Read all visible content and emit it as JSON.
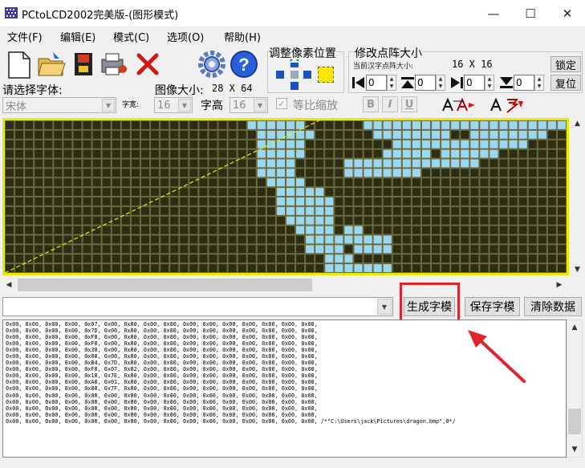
{
  "window": {
    "title": "PCtoLCD2002完美版-(图形模式)",
    "minimize_glyph": "—",
    "maximize_glyph": "☐",
    "close_glyph": "✕"
  },
  "menu": [
    "文件(F)",
    "编辑(E)",
    "模式(C)",
    "选项(O)",
    "帮助(H)"
  ],
  "toolbar": {
    "adjust_pixel_label": "调整像素位置",
    "resize_label": "修改点阵大小",
    "current_size_label": "当前汉字点阵大小:",
    "current_size_value": "16 X 16",
    "lock_button": "锁定",
    "reset_button": "复位"
  },
  "font": {
    "select_label": "请选择字体:",
    "font_value": "宋体",
    "width_label": "字宽:",
    "width_value": "16",
    "height_label": "字高",
    "height_value": "16",
    "scale_label": "等比缩放",
    "image_size_label": "图像大小:",
    "image_size_value": "28 X 64",
    "bold_label": "B",
    "italic_label": "I",
    "underline_label": "U"
  },
  "spinners": [
    "0",
    "0",
    "0",
    "0"
  ],
  "actions": {
    "generate_button": "生成字模",
    "save_button": "保存字模",
    "clear_button": "清除数据"
  },
  "colors": {
    "grid_background": "#2d2d14",
    "pixel_on": "#9cd7f0",
    "grid_frame": "#eaea00",
    "highlight_box": "#e0242b",
    "arrow": "#e0242b"
  },
  "grid": {
    "cols": 58,
    "rows": 16,
    "on_cells": [
      [
        0,
        25
      ],
      [
        0,
        26
      ],
      [
        0,
        27
      ],
      [
        0,
        28
      ],
      [
        0,
        29
      ],
      [
        0,
        30
      ],
      [
        0,
        37
      ],
      [
        0,
        38
      ],
      [
        0,
        39
      ],
      [
        0,
        40
      ],
      [
        0,
        41
      ],
      [
        0,
        42
      ],
      [
        0,
        43
      ],
      [
        0,
        44
      ],
      [
        0,
        45
      ],
      [
        0,
        46
      ],
      [
        0,
        47
      ],
      [
        0,
        48
      ],
      [
        0,
        49
      ],
      [
        0,
        50
      ],
      [
        0,
        51
      ],
      [
        0,
        52
      ],
      [
        0,
        53
      ],
      [
        0,
        54
      ],
      [
        0,
        55
      ],
      [
        0,
        56
      ],
      [
        0,
        57
      ],
      [
        1,
        26
      ],
      [
        1,
        27
      ],
      [
        1,
        28
      ],
      [
        1,
        29
      ],
      [
        1,
        30
      ],
      [
        1,
        31
      ],
      [
        1,
        38
      ],
      [
        1,
        39
      ],
      [
        1,
        40
      ],
      [
        1,
        41
      ],
      [
        1,
        42
      ],
      [
        1,
        43
      ],
      [
        1,
        44
      ],
      [
        1,
        45
      ],
      [
        1,
        48
      ],
      [
        1,
        49
      ],
      [
        1,
        50
      ],
      [
        1,
        51
      ],
      [
        1,
        52
      ],
      [
        1,
        53
      ],
      [
        1,
        54
      ],
      [
        1,
        55
      ],
      [
        2,
        26
      ],
      [
        2,
        27
      ],
      [
        2,
        28
      ],
      [
        2,
        29
      ],
      [
        2,
        30
      ],
      [
        2,
        40
      ],
      [
        2,
        41
      ],
      [
        2,
        42
      ],
      [
        2,
        43
      ],
      [
        2,
        44
      ],
      [
        2,
        45
      ],
      [
        2,
        46
      ],
      [
        2,
        47
      ],
      [
        2,
        48
      ],
      [
        2,
        49
      ],
      [
        2,
        50
      ],
      [
        2,
        51
      ],
      [
        2,
        52
      ],
      [
        2,
        53
      ],
      [
        3,
        26
      ],
      [
        3,
        27
      ],
      [
        3,
        28
      ],
      [
        3,
        29
      ],
      [
        3,
        30
      ],
      [
        3,
        39
      ],
      [
        3,
        40
      ],
      [
        3,
        41
      ],
      [
        3,
        42
      ],
      [
        3,
        43
      ],
      [
        3,
        45
      ],
      [
        3,
        46
      ],
      [
        3,
        47
      ],
      [
        3,
        48
      ],
      [
        3,
        49
      ],
      [
        3,
        50
      ],
      [
        4,
        26
      ],
      [
        4,
        27
      ],
      [
        4,
        28
      ],
      [
        4,
        29
      ],
      [
        4,
        35
      ],
      [
        4,
        36
      ],
      [
        4,
        37
      ],
      [
        4,
        38
      ],
      [
        4,
        39
      ],
      [
        4,
        40
      ],
      [
        4,
        41
      ],
      [
        4,
        42
      ],
      [
        4,
        43
      ],
      [
        4,
        44
      ],
      [
        4,
        45
      ],
      [
        4,
        46
      ],
      [
        4,
        47
      ],
      [
        4,
        48
      ],
      [
        5,
        26
      ],
      [
        5,
        27
      ],
      [
        5,
        28
      ],
      [
        5,
        29
      ],
      [
        5,
        35
      ],
      [
        5,
        36
      ],
      [
        5,
        37
      ],
      [
        5,
        38
      ],
      [
        5,
        39
      ],
      [
        5,
        40
      ],
      [
        5,
        41
      ],
      [
        5,
        42
      ],
      [
        6,
        27
      ],
      [
        6,
        28
      ],
      [
        6,
        29
      ],
      [
        6,
        30
      ],
      [
        7,
        28
      ],
      [
        7,
        29
      ],
      [
        7,
        30
      ],
      [
        7,
        31
      ],
      [
        7,
        32
      ],
      [
        8,
        28
      ],
      [
        8,
        29
      ],
      [
        8,
        30
      ],
      [
        8,
        31
      ],
      [
        8,
        32
      ],
      [
        8,
        33
      ],
      [
        9,
        28
      ],
      [
        9,
        29
      ],
      [
        9,
        30
      ],
      [
        9,
        31
      ],
      [
        9,
        32
      ],
      [
        9,
        33
      ],
      [
        10,
        29
      ],
      [
        10,
        30
      ],
      [
        10,
        31
      ],
      [
        10,
        32
      ],
      [
        10,
        33
      ],
      [
        11,
        30
      ],
      [
        11,
        31
      ],
      [
        11,
        32
      ],
      [
        11,
        33
      ],
      [
        11,
        35
      ],
      [
        11,
        36
      ],
      [
        12,
        31
      ],
      [
        12,
        32
      ],
      [
        12,
        33
      ],
      [
        12,
        34
      ],
      [
        12,
        35
      ],
      [
        12,
        36
      ],
      [
        12,
        37
      ],
      [
        12,
        38
      ],
      [
        12,
        39
      ],
      [
        13,
        31
      ],
      [
        13,
        32
      ],
      [
        13,
        33
      ],
      [
        13,
        34
      ],
      [
        13,
        36
      ],
      [
        13,
        37
      ],
      [
        13,
        38
      ],
      [
        13,
        39
      ],
      [
        14,
        33
      ],
      [
        14,
        34
      ],
      [
        14,
        35
      ],
      [
        15,
        33
      ],
      [
        15,
        34
      ],
      [
        15,
        35
      ],
      [
        15,
        36
      ],
      [
        15,
        37
      ],
      [
        15,
        38
      ],
      [
        15,
        39
      ]
    ]
  },
  "hex_lines": [
    "0x00, 0x00, 0x00, 0x00, 0x07, 0x00, 0x00, 0x00, 0x00, 0x00, 0x00, 0x00, 0x00, 0x00, 0x00, 0x00,",
    "0x00, 0x00, 0x00, 0x00, 0x7D, 0x00, 0x00, 0x00, 0x00, 0x00, 0x00, 0x00, 0x00, 0x00, 0x00, 0x00,",
    "0x00, 0x00, 0x00, 0x00, 0xF8, 0x00, 0x00, 0x00, 0x00, 0x00, 0x00, 0x00, 0x00, 0x00, 0x00, 0x00,",
    "0x00, 0x00, 0x00, 0x00, 0xF0, 0x00, 0x00, 0x00, 0x00, 0x00, 0x00, 0x00, 0x00, 0x00, 0x00, 0x00,",
    "0x00, 0x00, 0x00, 0x00, 0x38, 0x00, 0x00, 0x00, 0x00, 0x00, 0x00, 0x00, 0x00, 0x00, 0x00, 0x00,",
    "0x00, 0x00, 0x00, 0x00, 0x00, 0x00, 0x00, 0x00, 0x00, 0x00, 0x00, 0x00, 0x00, 0x00, 0x00, 0x00,",
    "0x00, 0x00, 0x00, 0x00, 0xB4, 0x7D, 0x00, 0x00, 0x00, 0x00, 0x00, 0x00, 0x00, 0x00, 0x00, 0x00,",
    "0x00, 0x00, 0x00, 0x00, 0xF0, 0x07, 0x02, 0x00, 0x00, 0x00, 0x00, 0x00, 0x00, 0x00, 0x00, 0x00,",
    "0x00, 0x00, 0x00, 0x00, 0x10, 0x7E, 0x00, 0x00, 0x00, 0x00, 0x00, 0x00, 0x00, 0x00, 0x00, 0x00,",
    "0x00, 0x00, 0x00, 0x00, 0xA0, 0x01, 0x00, 0x00, 0x00, 0x00, 0x00, 0x00, 0x00, 0x00, 0x00, 0x00,",
    "0x00, 0x00, 0x00, 0x00, 0x80, 0x7F, 0x00, 0x00, 0x00, 0x00, 0x00, 0x00, 0x00, 0x00, 0x00, 0x00,",
    "0x00, 0x00, 0x00, 0x00, 0x00, 0x00, 0x00, 0x00, 0x00, 0x00, 0x00, 0x00, 0x00, 0x00, 0x00, 0x00,",
    "0x00, 0x00, 0x00, 0x00, 0x00, 0x00, 0x00, 0x00, 0x00, 0x00, 0x00, 0x00, 0x00, 0x00, 0x00, 0x00,",
    "0x00, 0x00, 0x00, 0x00, 0x00, 0x00, 0x00, 0x00, 0x00, 0x00, 0x00, 0x00, 0x00, 0x00, 0x00, 0x00,",
    "0x00, 0x00, 0x00, 0x00, 0x00, 0x00, 0x00, 0x00, 0x00, 0x00, 0x00, 0x00, 0x00, 0x00, 0x00, 0x00,",
    "0x00, 0x00, 0x00, 0x00, 0x00, 0x00, 0x00, 0x00, 0x00, 0x00, 0x00, 0x00, 0x00, 0x00, 0x00, 0x00, /*\"C:\\Users\\jack\\Pictures\\dragon.bmp\",0*/"
  ]
}
